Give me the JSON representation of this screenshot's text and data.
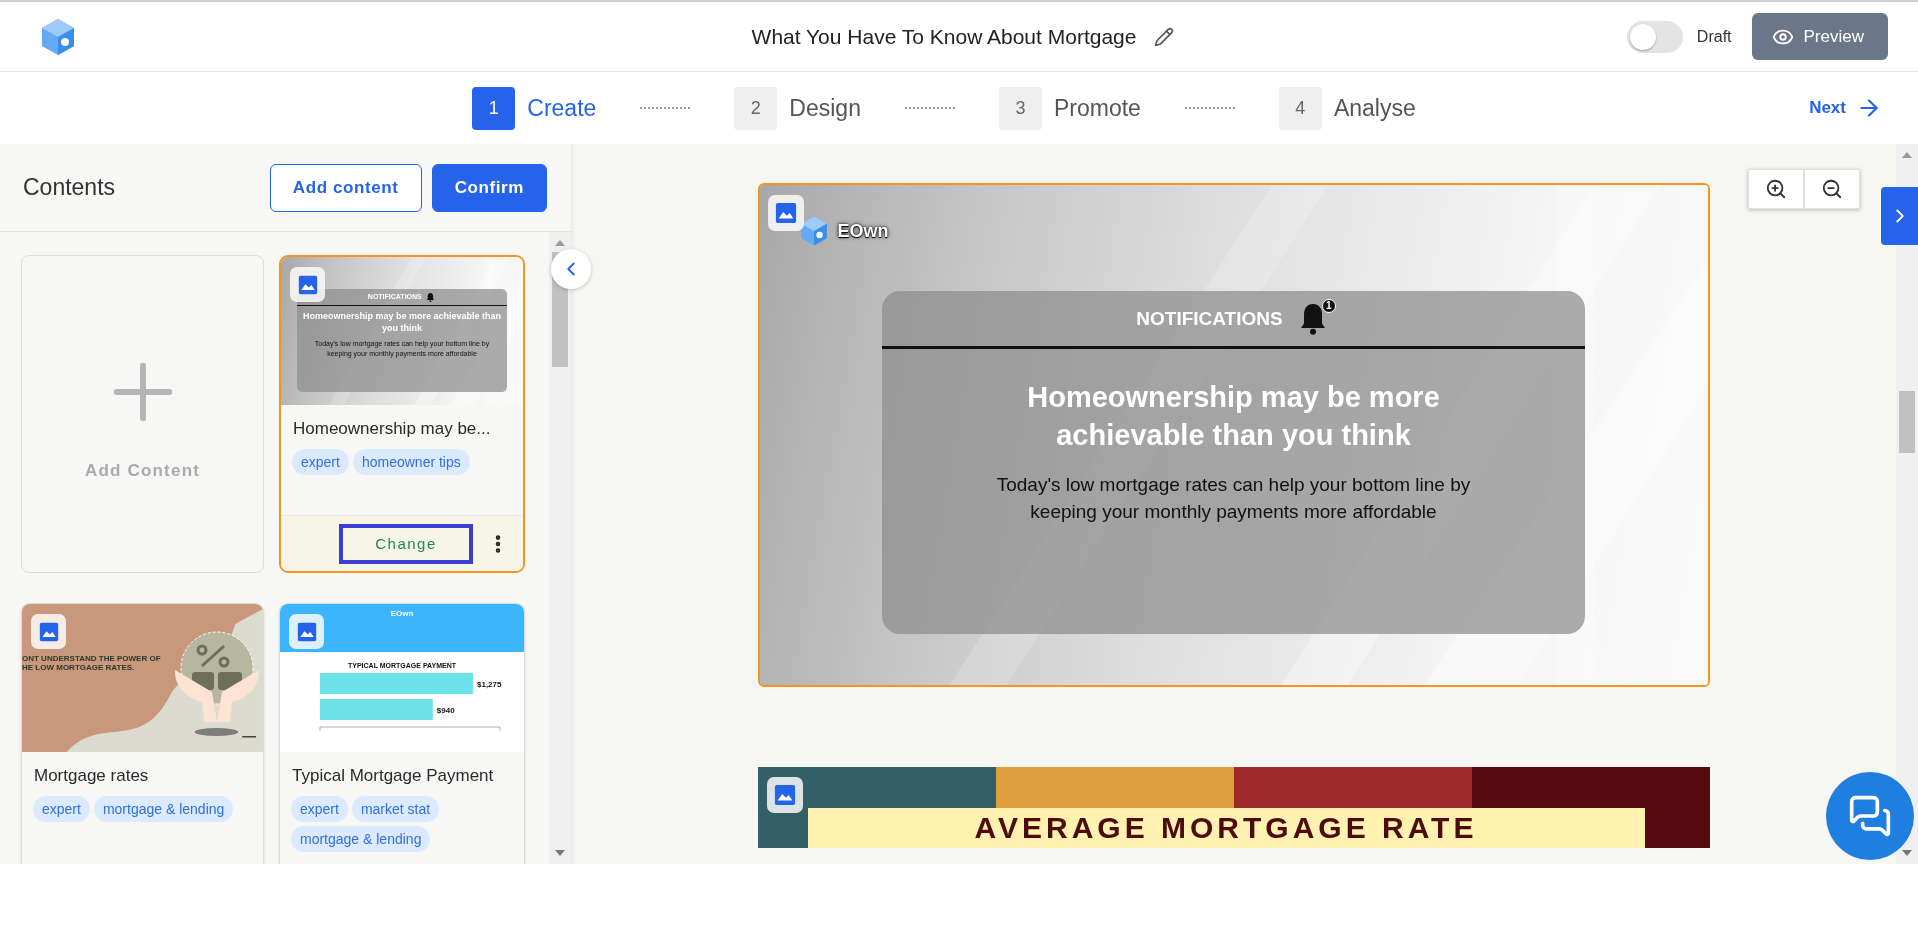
{
  "header": {
    "title": "What You Have To Know About Mortgage",
    "draft_toggle": {
      "label": "Draft",
      "on": false
    },
    "preview_button": "Preview"
  },
  "steps": [
    {
      "number": "1",
      "label": "Create",
      "selected": true
    },
    {
      "number": "2",
      "label": "Design",
      "selected": false
    },
    {
      "number": "3",
      "label": "Promote",
      "selected": false
    },
    {
      "number": "4",
      "label": "Analyse",
      "selected": false
    }
  ],
  "next_button": "Next",
  "contents_panel": {
    "title": "Contents",
    "add_content_button": "Add content",
    "confirm_button": "Confirm",
    "add_tile_label": "Add Content",
    "cards": [
      {
        "title": "Homeownership may be...",
        "selected": true,
        "tags": [
          "expert",
          "homeowner tips"
        ],
        "action_button": "Change",
        "thumbnail": {
          "kind": "notification",
          "header": "NOTIFICATIONS",
          "headline": "Homeownership may be more achievable than you think",
          "body": "Today's low mortgage rates can help your  bottom line by keeping your monthly payments more affordable"
        }
      },
      {
        "title": "Mortgage rates",
        "selected": false,
        "tags": [
          "expert",
          "mortgage & lending"
        ],
        "thumbnail": {
          "kind": "promo",
          "headline_lines": [
            "ONT UNDERSTAND THE POWER OF",
            "HE LOW MORTGAGE RATES."
          ]
        }
      },
      {
        "title": "Typical Mortgage Payment",
        "selected": false,
        "tags": [
          "expert",
          "market stat",
          "mortgage & lending"
        ],
        "thumbnail": {
          "kind": "chart",
          "brand": "EOwn",
          "chart_data": {
            "type": "bar",
            "orientation": "horizontal",
            "title": "TYPICAL MORTGAGE PAYMENT",
            "values": [
              1275,
              940
            ],
            "value_labels": [
              "$1,275",
              "$940"
            ],
            "xlim": [
              0,
              1500
            ],
            "color": "#6ce3e8"
          }
        }
      }
    ]
  },
  "canvas": {
    "slides": [
      {
        "kind": "notification",
        "selected": true,
        "brand": "EOwn",
        "header": "NOTIFICATIONS",
        "badge": "1",
        "headline": "Homeownership may be more achievable than you think",
        "body": "Today's low mortgage rates can help your  bottom line by keeping your monthly payments more affordable"
      },
      {
        "kind": "banner",
        "selected": false,
        "title": "AVERAGE MORTGAGE RATE"
      }
    ]
  }
}
